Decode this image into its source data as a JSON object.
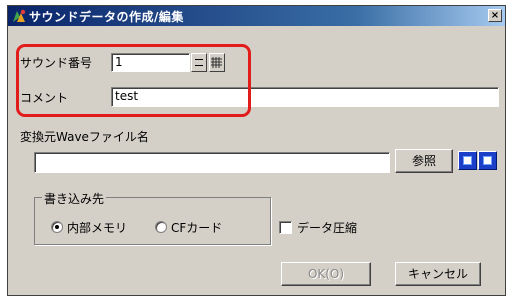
{
  "window": {
    "title": "サウンドデータの作成/編集",
    "close_label": "×"
  },
  "sound_number": {
    "label": "サウンド番号",
    "value": "1"
  },
  "comment": {
    "label": "コメント",
    "value": "test"
  },
  "source_file": {
    "label": "変換元Waveファイル名",
    "value": "",
    "browse_label": "参照"
  },
  "destination": {
    "group_label": "書き込み先",
    "options": [
      {
        "label": "内部メモリ",
        "selected": true
      },
      {
        "label": "CFカード",
        "selected": false
      }
    ]
  },
  "compress": {
    "label": "データ圧縮",
    "checked": false
  },
  "buttons": {
    "ok_label": "OK(O)",
    "cancel_label": "キャンセル"
  },
  "colors": {
    "highlight": "#e21b1b",
    "title_bar": "#0a246a",
    "media_button": "#1b3fc9"
  }
}
